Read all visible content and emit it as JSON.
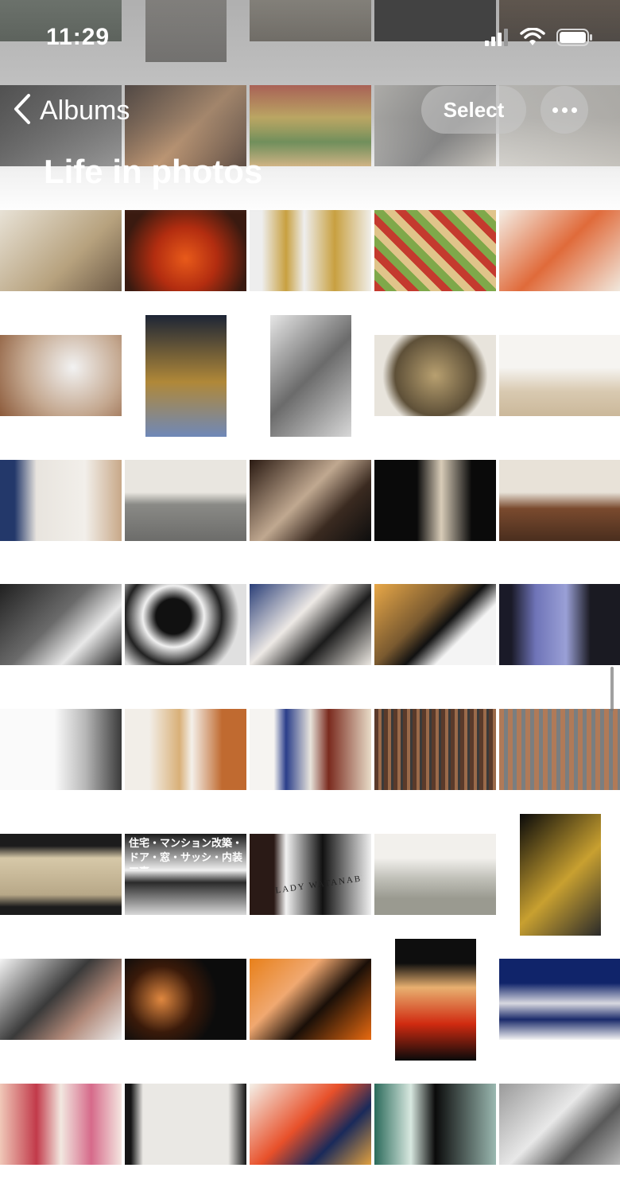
{
  "status_bar": {
    "time": "11:29"
  },
  "nav": {
    "back_label": "Albums",
    "select_label": "Select"
  },
  "album": {
    "title": "Life in photos"
  },
  "photos": [
    "top-row-0",
    "top-row-1",
    "top-row-2",
    "top-row-3",
    "top-row-4",
    "row1-0",
    "row1-1",
    "row1-2",
    "row1-3",
    "row1-4"
  ],
  "photo_signs": {
    "row6_1": "住宅・マンション改築・ドア・窓・サッシ・内装工事",
    "row6_2": "LADY WATANABE"
  }
}
